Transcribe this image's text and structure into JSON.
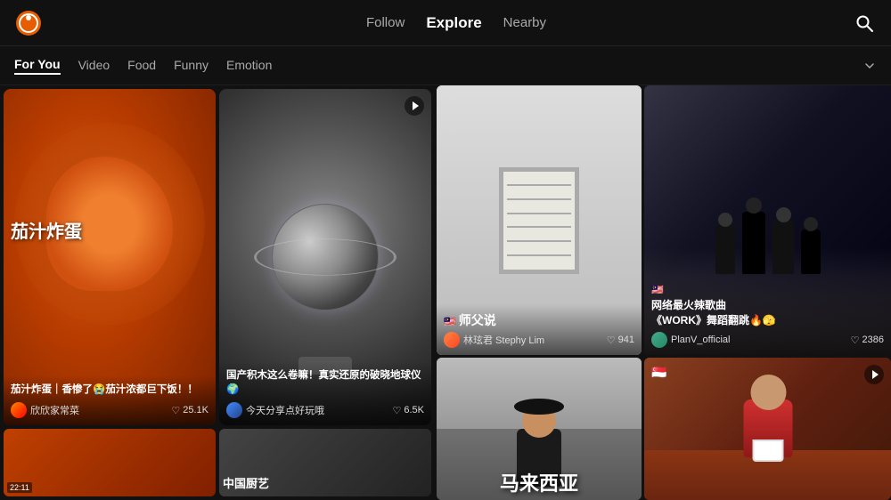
{
  "app": {
    "logo_icon": "circle-logo"
  },
  "topnav": {
    "tabs": [
      {
        "id": "follow",
        "label": "Follow",
        "active": false
      },
      {
        "id": "explore",
        "label": "Explore",
        "active": true
      },
      {
        "id": "nearby",
        "label": "Nearby",
        "active": false
      }
    ],
    "search_label": "Search"
  },
  "cattabs": {
    "tabs": [
      {
        "id": "for-you",
        "label": "For You",
        "active": true
      },
      {
        "id": "video",
        "label": "Video",
        "active": false
      },
      {
        "id": "food",
        "label": "Food",
        "active": false
      },
      {
        "id": "funny",
        "label": "Funny",
        "active": false
      },
      {
        "id": "emotion",
        "label": "Emotion",
        "active": false
      }
    ],
    "more_label": "More"
  },
  "left_cards": {
    "card1": {
      "cn_text": "茄汁炸蛋",
      "title": "茄汁炸蛋｜香惨了😭茄汁浓都巨下饭！！",
      "author": "欣欣家常菜",
      "likes": "25.1K",
      "has_play": false
    },
    "card2": {
      "title": "国产积木这么卷嘛！真实还原的破晓地球仪🌍",
      "author": "今天分享点好玩哦",
      "likes": "6.5K",
      "has_play": true
    }
  },
  "left_bottom": {
    "card1_time": "22:11",
    "card2_text": "中国厨艺"
  },
  "right_cards": {
    "door": {
      "flag": "🇲🇾",
      "title": "师父说",
      "author": "林玹君 Stephy Lim",
      "likes": "941"
    },
    "dance": {
      "flag": "🇲🇾",
      "title_line1": "网络最火辣歌曲",
      "title_line2": "《WORK》舞蹈翻跳🔥🫣",
      "author": "PlanV_official",
      "likes": "2386"
    },
    "malaysia": {
      "text": "马来西亚"
    },
    "ramen": {
      "flag": "🇸🇬",
      "has_play": true
    }
  }
}
